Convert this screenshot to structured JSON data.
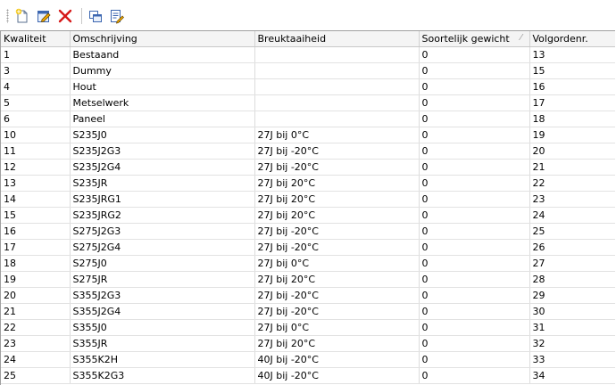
{
  "toolbar": {
    "buttons": [
      {
        "name": "new-record-icon"
      },
      {
        "name": "edit-record-icon"
      },
      {
        "name": "delete-record-icon"
      },
      {
        "name": "copy-record-icon"
      },
      {
        "name": "properties-icon"
      }
    ]
  },
  "grid": {
    "columns": [
      {
        "label": "Kwaliteit"
      },
      {
        "label": "Omschrijving"
      },
      {
        "label": "Breuktaaiheid"
      },
      {
        "label": "Soortelijk gewicht"
      },
      {
        "label": "Volgordenr."
      }
    ],
    "sort_indicator": "⁄",
    "rows": [
      [
        "1",
        "Bestaand",
        "",
        "0",
        "13"
      ],
      [
        "3",
        "Dummy",
        "",
        "0",
        "15"
      ],
      [
        "4",
        "Hout",
        "",
        "0",
        "16"
      ],
      [
        "5",
        "Metselwerk",
        "",
        "0",
        "17"
      ],
      [
        "6",
        "Paneel",
        "",
        "0",
        "18"
      ],
      [
        "10",
        "S235J0",
        "27J bij 0°C",
        "0",
        "19"
      ],
      [
        "11",
        "S235J2G3",
        "27J bij -20°C",
        "0",
        "20"
      ],
      [
        "12",
        "S235J2G4",
        "27J bij -20°C",
        "0",
        "21"
      ],
      [
        "13",
        "S235JR",
        "27J bij 20°C",
        "0",
        "22"
      ],
      [
        "14",
        "S235JRG1",
        "27J bij 20°C",
        "0",
        "23"
      ],
      [
        "15",
        "S235JRG2",
        "27J bij 20°C",
        "0",
        "24"
      ],
      [
        "16",
        "S275J2G3",
        "27J bij -20°C",
        "0",
        "25"
      ],
      [
        "17",
        "S275J2G4",
        "27J bij -20°C",
        "0",
        "26"
      ],
      [
        "18",
        "S275J0",
        "27J bij 0°C",
        "0",
        "27"
      ],
      [
        "19",
        "S275JR",
        "27J bij 20°C",
        "0",
        "28"
      ],
      [
        "20",
        "S355J2G3",
        "27J bij -20°C",
        "0",
        "29"
      ],
      [
        "21",
        "S355J2G4",
        "27J bij -20°C",
        "0",
        "30"
      ],
      [
        "22",
        "S355J0",
        "27J bij 0°C",
        "0",
        "31"
      ],
      [
        "23",
        "S355JR",
        "27J bij 20°C",
        "0",
        "32"
      ],
      [
        "24",
        "S355K2H",
        "40J bij -20°C",
        "0",
        "33"
      ],
      [
        "25",
        "S355K2G3",
        "40J bij -20°C",
        "0",
        "34"
      ]
    ]
  }
}
